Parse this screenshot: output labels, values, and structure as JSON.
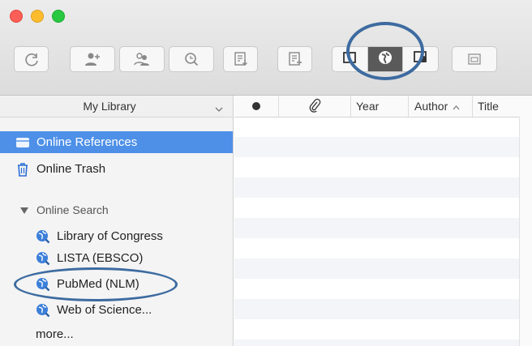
{
  "toolbar": {
    "buttons": [
      {
        "name": "sync-button",
        "icon": "sync-icon"
      },
      {
        "name": "share-library-button",
        "icon": "person-plus-icon"
      },
      {
        "name": "share-group-button",
        "icon": "people-icon"
      },
      {
        "name": "find-full-text-button",
        "icon": "magnify-icon"
      },
      {
        "name": "import-button",
        "icon": "import-icon"
      },
      {
        "name": "export-button",
        "icon": "export-icon"
      },
      {
        "name": "folder-button",
        "icon": "folder-icon"
      }
    ],
    "mode_segments": [
      "local-library-icon",
      "online-search-icon",
      "integrated-library-icon"
    ],
    "active_segment": "online-search-icon"
  },
  "sidebar": {
    "library_selector": "My Library",
    "items": [
      {
        "label": "Online References",
        "icon": "online-references-icon",
        "selected": true
      },
      {
        "label": "Online Trash",
        "icon": "trash-icon"
      }
    ],
    "online_search_header": "Online Search",
    "search_items": [
      {
        "label": "Library of Congress",
        "icon": "search-globe-icon"
      },
      {
        "label": "LISTA (EBSCO)",
        "icon": "search-globe-icon"
      },
      {
        "label": "PubMed (NLM)",
        "icon": "search-globe-icon",
        "highlighted": true
      },
      {
        "label": "Web of Science...",
        "icon": "search-globe-icon"
      }
    ],
    "more_label": "more..."
  },
  "table": {
    "columns": [
      "Year",
      "Author",
      "Title"
    ],
    "sort_column": "Author",
    "sort_direction": "ascending"
  },
  "colors": {
    "selection": "#4e90e8",
    "annotation": "#3d6ba0"
  }
}
